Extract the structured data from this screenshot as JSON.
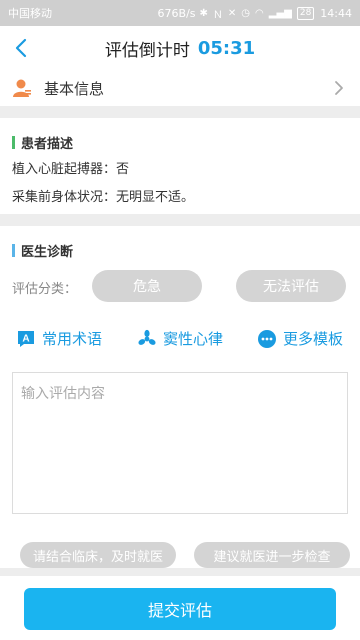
{
  "status_bar": {
    "carrier": "中国移动",
    "speed": "676B/s",
    "battery": "28",
    "time": "14:44"
  },
  "header": {
    "title": "评估倒计时",
    "countdown": "05:31"
  },
  "basic_info": {
    "label": "基本信息"
  },
  "patient_description": {
    "title": "患者描述",
    "lines": [
      "植入心脏起搏器：否",
      "采集前身体状况：无明显不适。"
    ]
  },
  "doctor_diagnosis": {
    "title": "医生诊断",
    "classification_label": "评估分类：",
    "options": [
      "危急",
      "无法评估"
    ],
    "tools": [
      "常用术语",
      "窦性心律",
      "更多模板"
    ],
    "input_placeholder": "输入评估内容",
    "quick_phrases": [
      "请结合临床，及时就医",
      "建议就医进一步检查"
    ]
  },
  "submit_label": "提交评估",
  "colors": {
    "accent": "#1a9be0",
    "submit": "#1ab4f0",
    "patient_bar": "#4cbb6a",
    "doctor_bar": "#5ab4e8",
    "user_icon": "#f08a4b"
  }
}
